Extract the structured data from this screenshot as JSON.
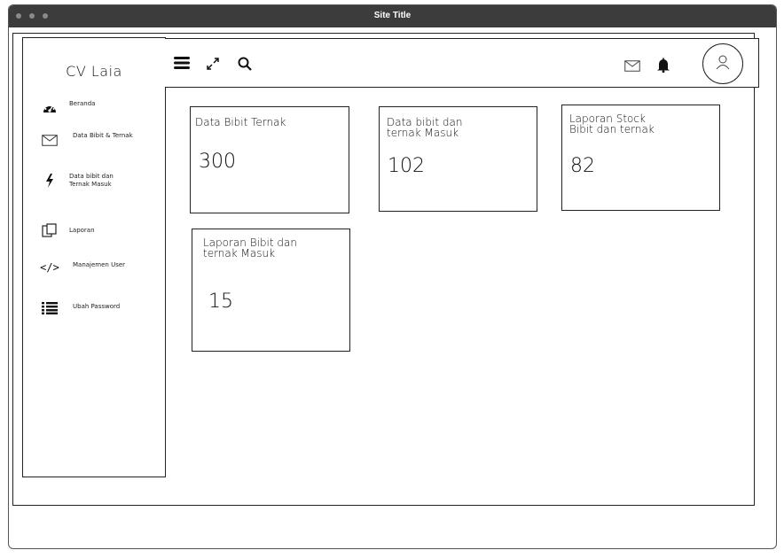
{
  "window": {
    "title": "Site Title"
  },
  "sidebar": {
    "brand": "CV Laia",
    "items": [
      {
        "label": "Beranda",
        "icon": "dashboard-icon"
      },
      {
        "label": "Data Bibit & Ternak",
        "icon": "envelope-icon"
      },
      {
        "label": "Data bibit dan Ternak Masuk",
        "icon": "lightning-icon"
      },
      {
        "label": "Laporan",
        "icon": "copy-icon"
      },
      {
        "label": "Manajemen User",
        "icon": "code-icon"
      },
      {
        "label": "Ubah Password",
        "icon": "list-icon"
      }
    ]
  },
  "topbar": {
    "icons": [
      "menu-icon",
      "expand-icon",
      "search-icon",
      "mail-icon",
      "bell-icon",
      "user-avatar-icon"
    ]
  },
  "cards": [
    {
      "title": "Data Bibit Ternak",
      "value": "300"
    },
    {
      "title": "Data bibit dan\nternak Masuk",
      "value": "102"
    },
    {
      "title": "Laporan Stock\nBibit dan ternak",
      "value": "82"
    },
    {
      "title": "Laporan Bibit dan\nternak Masuk",
      "value": "15"
    }
  ]
}
